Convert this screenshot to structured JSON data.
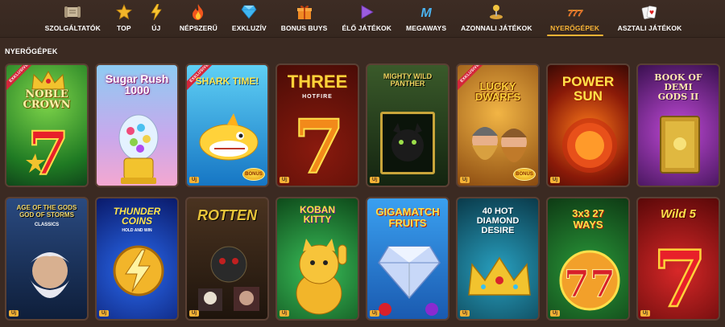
{
  "nav": {
    "items": [
      {
        "label": "SZOLGÁLTATÓK",
        "icon": "scroll-icon"
      },
      {
        "label": "TOP",
        "icon": "star-icon"
      },
      {
        "label": "ÚJ",
        "icon": "lightning-icon"
      },
      {
        "label": "NÉPSZERŰ",
        "icon": "flame-icon"
      },
      {
        "label": "EXKLUZÍV",
        "icon": "diamond-icon"
      },
      {
        "label": "BONUS BUYS",
        "icon": "gift-icon"
      },
      {
        "label": "ÉLŐ JÁTÉKOK",
        "icon": "play-icon"
      },
      {
        "label": "MEGAWAYS",
        "icon": "megaways-icon"
      },
      {
        "label": "AZONNALI JÁTÉKOK",
        "icon": "joystick-icon"
      },
      {
        "label": "NYERŐGÉPEK",
        "icon": "slot-777-icon"
      },
      {
        "label": "ASZTALI JÁTÉKOK",
        "icon": "cards-icon"
      }
    ],
    "active": "NYERŐGÉPEK",
    "active_color": "#f7b335"
  },
  "section": {
    "title": "NYERŐGÉPEK"
  },
  "badges": {
    "new": "Új",
    "exclusive": "EXKLUSIVE",
    "bonus": "BONUS"
  },
  "games": [
    {
      "title": "NOBLE CROWN",
      "accent": "#2e8b2e"
    },
    {
      "title": "Sugar Rush 1000",
      "accent": "#f3a6d8"
    },
    {
      "title": "SHARK TIME!",
      "accent": "#1e9ad6"
    },
    {
      "title": "THREE",
      "subtitle": "HOTFIRE",
      "accent": "#b51d12"
    },
    {
      "title": "MIGHTY WILD PANTHER",
      "accent": "#1f3d1a"
    },
    {
      "title": "LUCKY DWARFS",
      "accent": "#e09a1c"
    },
    {
      "title": "POWER SUN",
      "accent": "#d33a10"
    },
    {
      "title": "BOOK OF DEMI GODS II",
      "accent": "#6b2fa0"
    },
    {
      "title": "AGE OF THE GODS GOD OF STORMS",
      "subtitle": "CLASSICS",
      "accent": "#2a4a7a"
    },
    {
      "title": "THUNDER COINS",
      "subtitle": "HOLD AND WIN",
      "accent": "#1a3fbf"
    },
    {
      "title": "ROTTEN",
      "accent": "#5c3b1e"
    },
    {
      "title": "KOBAN KITTY",
      "accent": "#1a8a3a"
    },
    {
      "title": "GIGAMATCH FRUITS",
      "accent": "#2a7bd4"
    },
    {
      "title": "40 HOT DIAMOND DESIRE",
      "accent": "#0f6f8a"
    },
    {
      "title": "3x3 27 WAYS",
      "accent": "#b81b1b"
    },
    {
      "title": "Wild 5",
      "accent": "#c21818"
    }
  ]
}
